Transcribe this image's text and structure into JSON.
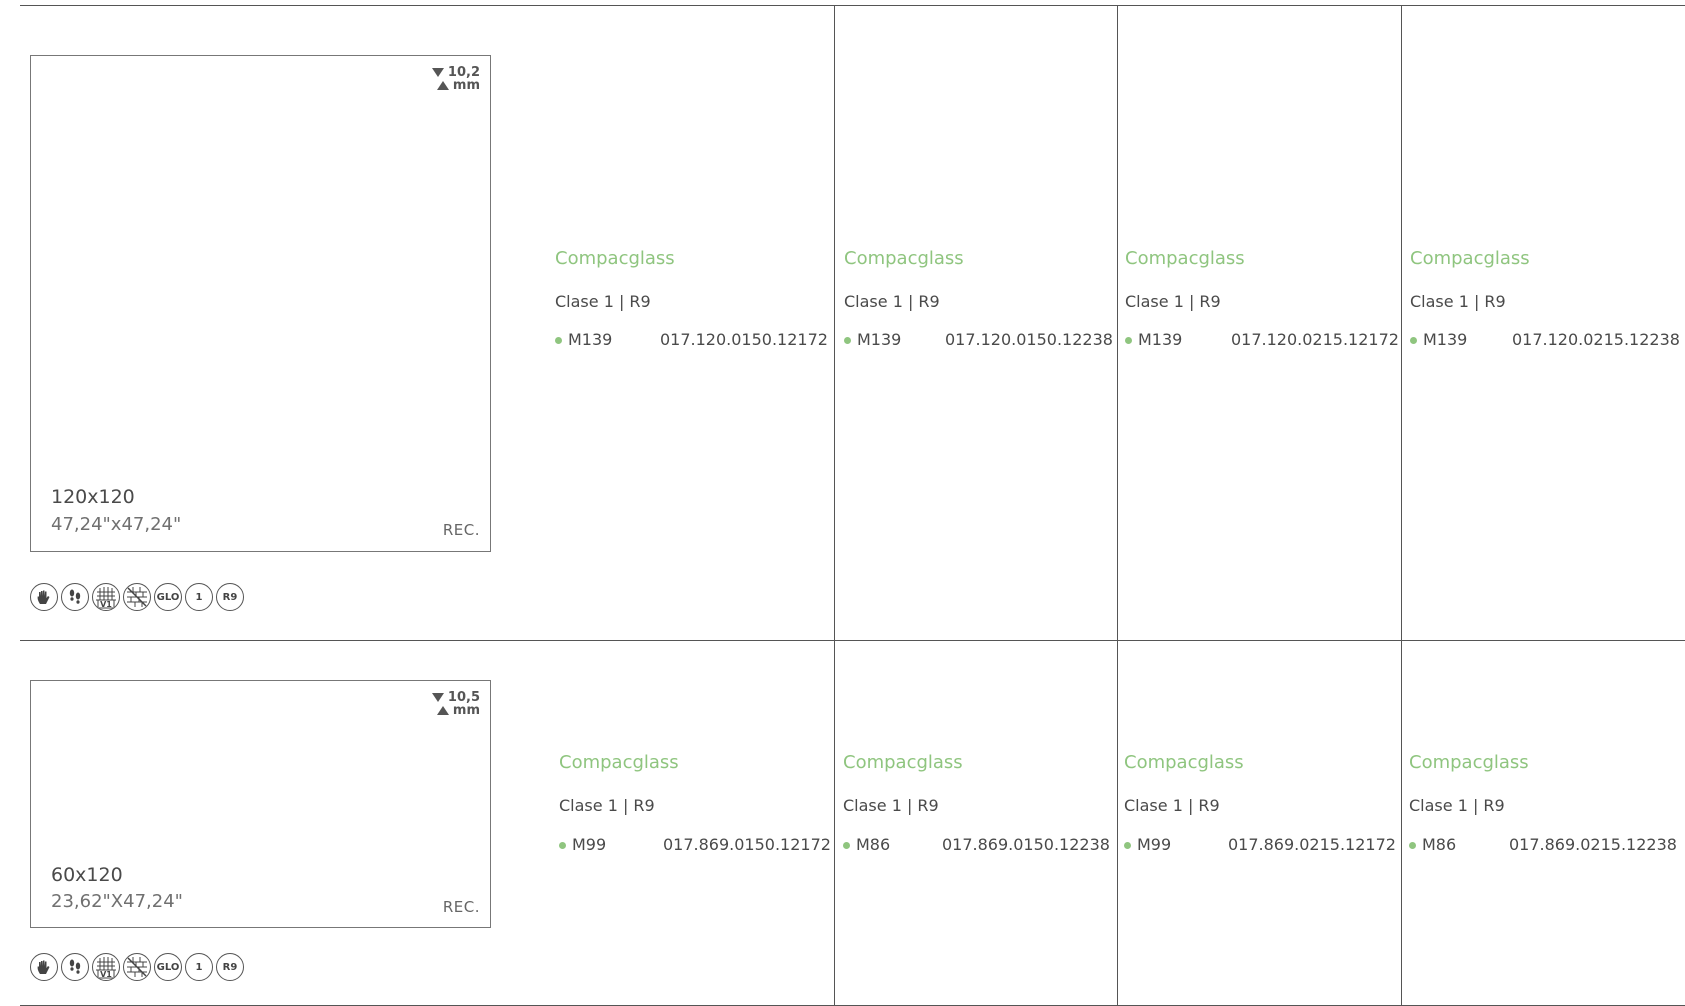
{
  "accent_color": "#8fc57f",
  "rows": [
    {
      "tile": {
        "thickness_value": "10,2",
        "thickness_unit": "mm",
        "size_cm": "120x120",
        "size_in": "47,24\"x47,24\"",
        "rec": "REC."
      },
      "icons": [
        {
          "name": "hand-icon",
          "label": ""
        },
        {
          "name": "footprints-icon",
          "label": ""
        },
        {
          "name": "grid-v1-icon",
          "label": "V1"
        },
        {
          "name": "wall-crossed-icon",
          "label": ""
        },
        {
          "name": "glo-icon",
          "label": "GLO"
        },
        {
          "name": "clase-1-icon",
          "label": "1"
        },
        {
          "name": "r9-icon",
          "label": "R9"
        }
      ],
      "products": [
        {
          "name": "Compacglass",
          "class": "Clase 1 | R9",
          "model": "M139",
          "code": "017.120.0150.12172"
        },
        {
          "name": "Compacglass",
          "class": "Clase 1 | R9",
          "model": "M139",
          "code": "017.120.0150.12238"
        },
        {
          "name": "Compacglass",
          "class": "Clase 1 | R9",
          "model": "M139",
          "code": "017.120.0215.12172"
        },
        {
          "name": "Compacglass",
          "class": "Clase 1 | R9",
          "model": "M139",
          "code": "017.120.0215.12238"
        }
      ]
    },
    {
      "tile": {
        "thickness_value": "10,5",
        "thickness_unit": "mm",
        "size_cm": "60x120",
        "size_in": "23,62\"X47,24\"",
        "rec": "REC."
      },
      "icons": [
        {
          "name": "hand-icon",
          "label": ""
        },
        {
          "name": "footprints-icon",
          "label": ""
        },
        {
          "name": "grid-v1-icon",
          "label": "V1"
        },
        {
          "name": "wall-crossed-icon",
          "label": ""
        },
        {
          "name": "glo-icon",
          "label": "GLO"
        },
        {
          "name": "clase-1-icon",
          "label": "1"
        },
        {
          "name": "r9-icon",
          "label": "R9"
        }
      ],
      "products": [
        {
          "name": "Compacglass",
          "class": "Clase 1 | R9",
          "model": "M99",
          "code": "017.869.0150.12172"
        },
        {
          "name": "Compacglass",
          "class": "Clase 1 | R9",
          "model": "M86",
          "code": "017.869.0150.12238"
        },
        {
          "name": "Compacglass",
          "class": "Clase 1 | R9",
          "model": "M99",
          "code": "017.869.0215.12172"
        },
        {
          "name": "Compacglass",
          "class": "Clase 1 | R9",
          "model": "M86",
          "code": "017.869.0215.12238"
        }
      ]
    }
  ]
}
